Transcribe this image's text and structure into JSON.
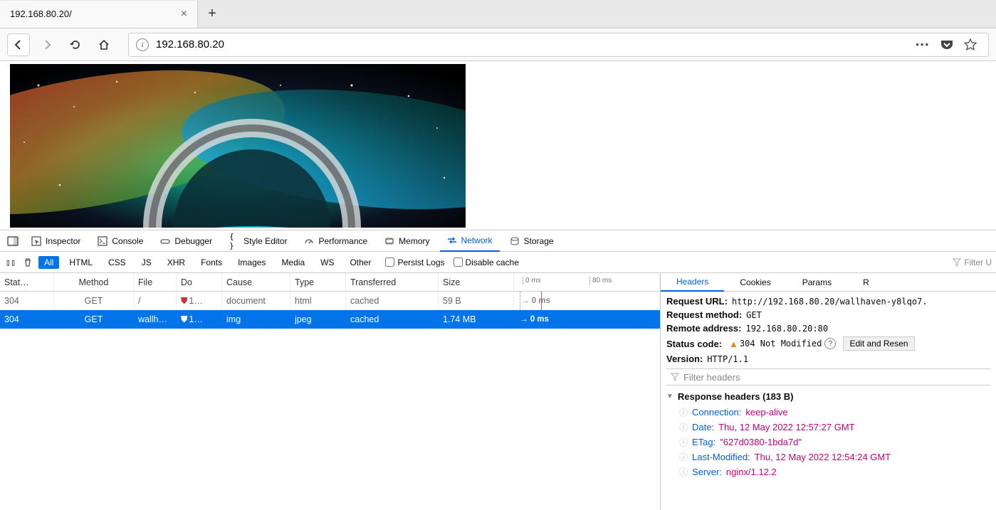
{
  "tab": {
    "title": "192.168.80.20/"
  },
  "url": {
    "value": "192.168.80.20"
  },
  "devtools": {
    "tabs": {
      "inspector": "Inspector",
      "console": "Console",
      "debugger": "Debugger",
      "style": "Style Editor",
      "perf": "Performance",
      "memory": "Memory",
      "network": "Network",
      "storage": "Storage"
    },
    "filters": {
      "all": "All",
      "html": "HTML",
      "css": "CSS",
      "js": "JS",
      "xhr": "XHR",
      "fonts": "Fonts",
      "images": "Images",
      "media": "Media",
      "ws": "WS",
      "other": "Other"
    },
    "persist": "Persist Logs",
    "disable_cache": "Disable cache",
    "filter_urls": "Filter U"
  },
  "columns": {
    "status": "Stat…",
    "method": "Method",
    "file": "File",
    "domain": "Do",
    "cause": "Cause",
    "type": "Type",
    "transferred": "Transferred",
    "size": "Size"
  },
  "waterfall": {
    "t0": "0 ms",
    "t1": "80 ms"
  },
  "rows": [
    {
      "status": "304",
      "method": "GET",
      "file": "/",
      "domain": "1…",
      "cause": "document",
      "type": "html",
      "transferred": "cached",
      "size": "59 B",
      "wf": "0 ms"
    },
    {
      "status": "304",
      "method": "GET",
      "file": "wallh…",
      "domain": "1…",
      "cause": "img",
      "type": "jpeg",
      "transferred": "cached",
      "size": "1.74 MB",
      "wf": "→ 0 ms"
    }
  ],
  "details": {
    "tabs": {
      "headers": "Headers",
      "cookies": "Cookies",
      "params": "Params",
      "response": "R"
    },
    "request_url_k": "Request URL:",
    "request_url_v": "http://192.168.80.20/wallhaven-y8lqo7.",
    "method_k": "Request method:",
    "method_v": "GET",
    "remote_k": "Remote address:",
    "remote_v": "192.168.80.20:80",
    "status_k": "Status code:",
    "status_v": "304 Not Modified",
    "edit": "Edit and Resen",
    "version_k": "Version:",
    "version_v": "HTTP/1.1",
    "filter_headers": "Filter headers",
    "resp_section": "Response headers (183 B)",
    "headers": [
      {
        "k": "Connection:",
        "v": "keep-alive"
      },
      {
        "k": "Date:",
        "v": "Thu, 12 May 2022 12:57:27 GMT"
      },
      {
        "k": "ETag:",
        "v": "\"627d0380-1bda7d\""
      },
      {
        "k": "Last-Modified:",
        "v": "Thu, 12 May 2022 12:54:24 GMT"
      },
      {
        "k": "Server:",
        "v": "nginx/1.12.2"
      }
    ]
  }
}
